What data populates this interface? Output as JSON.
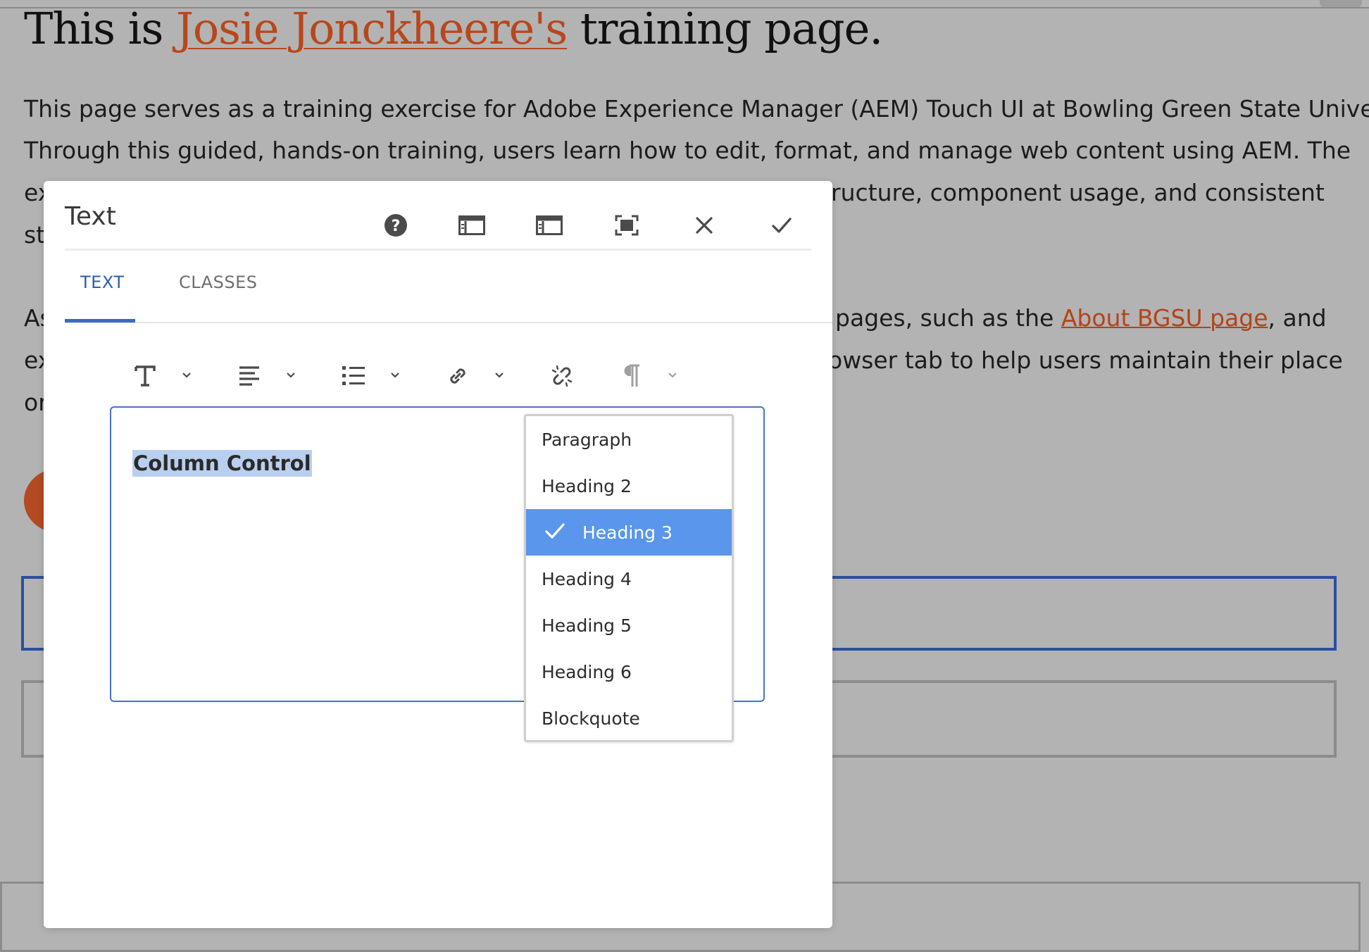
{
  "page": {
    "title_prefix": "This is ",
    "title_name": "Josie Jonckheere's",
    "title_suffix": " training page.",
    "intro_line1": "This page serves as a training exercise for Adobe Experience Manager (AEM) Touch UI at Bowling Green State University.",
    "intro_line2": "Through this guided, hands-on training, users learn how to edit, format, and manage web content using AEM. The",
    "intro_line3_left": "ex",
    "intro_line3_right": "ructure, component usage, and consistent",
    "intro_line4_left": "st",
    "second_line1_left": "As",
    "second_line1_right_pre": "pages, such as the ",
    "second_line1_link": "About BGSU page",
    "second_line1_right_post": ", and",
    "second_line2_left": "ex",
    "second_line2_right": "owser tab to help users maintain their place",
    "second_line3_left": "or"
  },
  "dialog": {
    "title": "Text",
    "tabs": [
      {
        "label": "TEXT",
        "active": true
      },
      {
        "label": "CLASSES",
        "active": false
      }
    ],
    "editor_text": "Column Control",
    "format_options": [
      {
        "label": "Paragraph",
        "selected": false
      },
      {
        "label": "Heading 2",
        "selected": false
      },
      {
        "label": "Heading 3",
        "selected": true
      },
      {
        "label": "Heading 4",
        "selected": false
      },
      {
        "label": "Heading 5",
        "selected": false
      },
      {
        "label": "Heading 6",
        "selected": false
      },
      {
        "label": "Blockquote",
        "selected": false
      }
    ],
    "header_icons": [
      "help-icon",
      "dock-left-icon",
      "dock-right-icon",
      "fullscreen-icon",
      "close-icon",
      "done-check-icon"
    ],
    "toolbar_icons": [
      "text-format-icon",
      "align-icon",
      "list-icon",
      "link-icon",
      "unlink-icon",
      "paragraph-icon"
    ]
  },
  "colors": {
    "accent_blue": "#5a96eb",
    "tab_active": "#2d5ea8",
    "link_orange": "#b3441a",
    "backdrop": "#b3b3b3"
  }
}
